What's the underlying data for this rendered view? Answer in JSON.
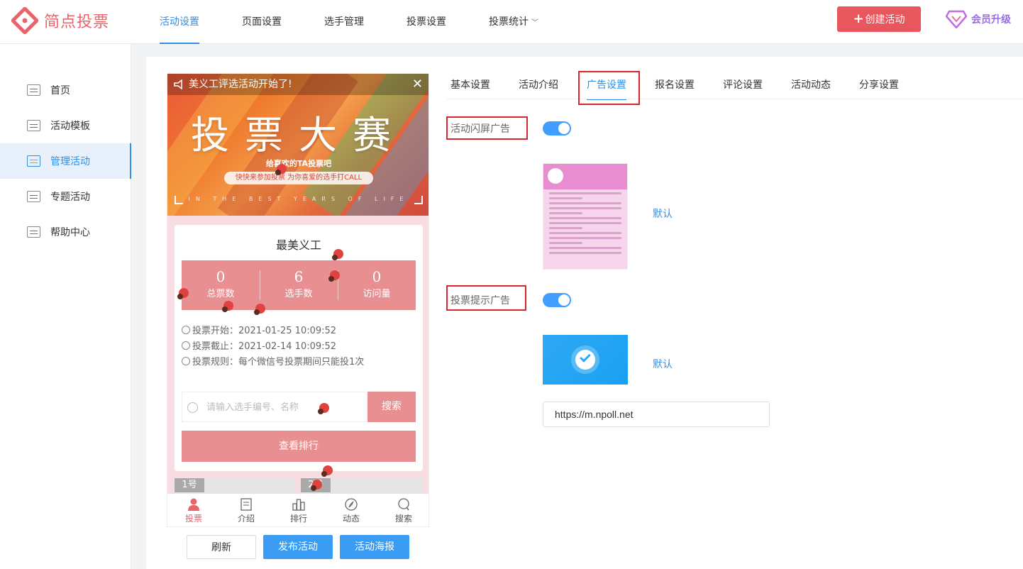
{
  "app": {
    "logo_text": "简点投票",
    "brand_color": "#e8575d"
  },
  "topnav": {
    "items": [
      "活动设置",
      "页面设置",
      "选手管理",
      "投票设置",
      "投票统计"
    ],
    "active_index": 0,
    "create_label": "创建活动",
    "vip_label": "会员升级"
  },
  "sidebar": {
    "items": [
      {
        "label": "首页",
        "icon": "home-card-icon"
      },
      {
        "label": "活动模板",
        "icon": "template-icon"
      },
      {
        "label": "管理活动",
        "icon": "manage-icon"
      },
      {
        "label": "专题活动",
        "icon": "topic-icon"
      },
      {
        "label": "帮助中心",
        "icon": "help-icon"
      }
    ],
    "active_index": 2
  },
  "preview": {
    "notice": "美义工评选活动开始了!",
    "banner_title": "投票大赛",
    "banner_subtitle": "给喜欢的TA投票吧",
    "banner_pill": "快快来参加投票 为你喜爱的选手打CALL",
    "banner_footer": "IN THE BEST YEARS OF LIFE",
    "card_title": "最美义工",
    "stats": [
      {
        "value": "0",
        "label": "总票数"
      },
      {
        "value": "6",
        "label": "选手数"
      },
      {
        "value": "0",
        "label": "访问量"
      }
    ],
    "vote_start": "投票开始：2021-01-25 10:09:52",
    "vote_end": "投票截止：2021-02-14 10:09:52",
    "vote_rule": "投票规则：每个微信号投票期间只能投1次",
    "search_placeholder": "请输入选手编号、名称",
    "search_button": "搜索",
    "rank_button": "查看排行",
    "player_tags": [
      "1号",
      "2号"
    ],
    "tabbar": [
      {
        "label": "投票",
        "icon": "person-icon"
      },
      {
        "label": "介绍",
        "icon": "document-icon"
      },
      {
        "label": "排行",
        "icon": "rank-icon"
      },
      {
        "label": "动态",
        "icon": "compass-icon"
      },
      {
        "label": "搜索",
        "icon": "search-icon"
      }
    ],
    "active_tab": 0,
    "buttons": {
      "refresh": "刷新",
      "publish": "发布活动",
      "poster": "活动海报"
    }
  },
  "settings": {
    "tabs": [
      "基本设置",
      "活动介绍",
      "广告设置",
      "报名设置",
      "评论设置",
      "活动动态",
      "分享设置"
    ],
    "active_index": 2,
    "splash_ad": {
      "label": "活动闪屏广告",
      "enabled": true,
      "default_label": "默认"
    },
    "vote_tip_ad": {
      "label": "投票提示广告",
      "enabled": true,
      "default_label": "默认",
      "url": "https://m.npoll.net"
    }
  }
}
